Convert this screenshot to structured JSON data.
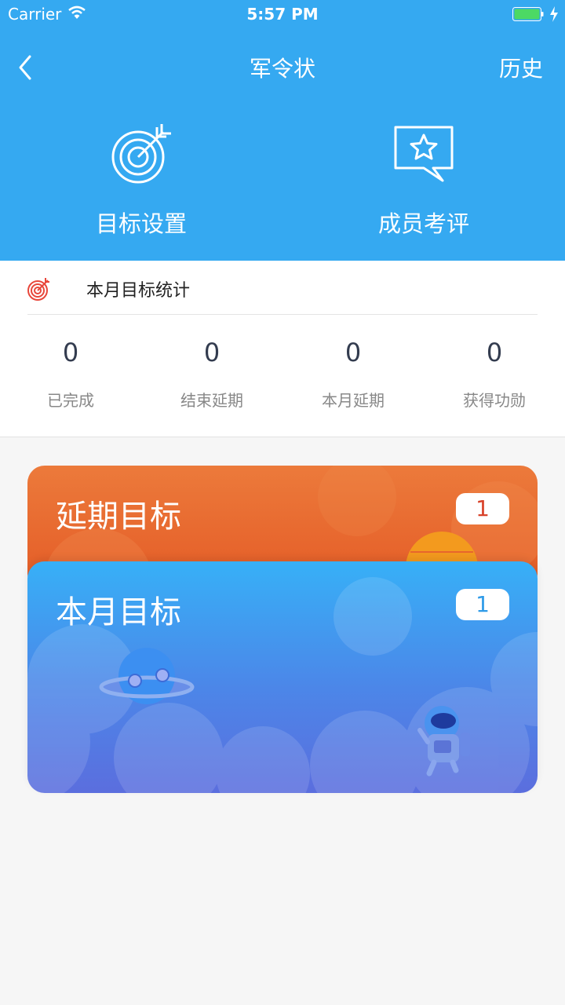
{
  "status_bar": {
    "carrier": "Carrier",
    "time": "5:57 PM"
  },
  "nav": {
    "title": "军令状",
    "history": "历史"
  },
  "hero": {
    "goal_setting": "目标设置",
    "member_review": "成员考评"
  },
  "stats": {
    "title": "本月目标统计",
    "items": [
      {
        "value": "0",
        "label": "已完成"
      },
      {
        "value": "0",
        "label": "结束延期"
      },
      {
        "value": "0",
        "label": "本月延期"
      },
      {
        "value": "0",
        "label": "获得功勋"
      }
    ]
  },
  "cards": {
    "delayed": {
      "title": "延期目标",
      "count": "1"
    },
    "month": {
      "title": "本月目标",
      "count": "1"
    }
  },
  "colors": {
    "header": "#35a9f1",
    "delayed_card": "#e8662d",
    "month_card": "#37b0f7"
  }
}
